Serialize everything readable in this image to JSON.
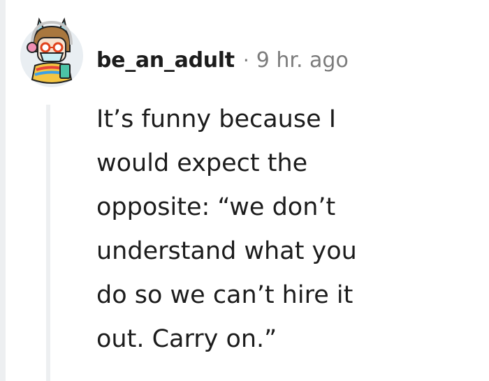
{
  "comment": {
    "username": "be_an_adult",
    "separator": "·",
    "timestamp": "9 hr. ago",
    "avatar_icon": "user-avatar-cat-ears-headphones",
    "body_lines": [
      "It’s funny because I",
      "would expect the",
      "opposite: “we don’t",
      "understand what you",
      "do so we can’t hire it",
      "out. Carry on.”"
    ]
  },
  "colors": {
    "text": "#1c1c1c",
    "meta": "#7c7c7c",
    "thread_line": "#edeff1"
  }
}
